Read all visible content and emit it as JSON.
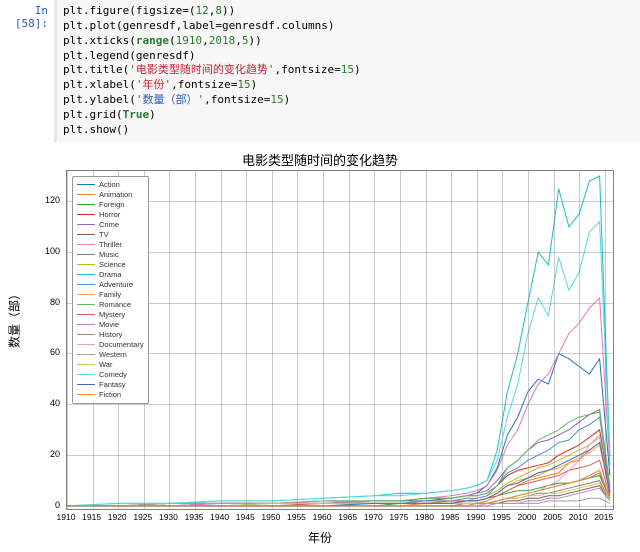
{
  "prompt": "In [58]:",
  "code": [
    [
      {
        "t": "plt.figure(figsize=("
      },
      {
        "t": "12",
        "c": "num"
      },
      {
        "t": ","
      },
      {
        "t": "8",
        "c": "num"
      },
      {
        "t": "))"
      }
    ],
    [
      {
        "t": "plt.plot(genresdf,label=genresdf.columns)"
      }
    ],
    [
      {
        "t": "plt.xticks("
      },
      {
        "t": "range",
        "c": "kw"
      },
      {
        "t": "("
      },
      {
        "t": "1910",
        "c": "num"
      },
      {
        "t": ","
      },
      {
        "t": "2018",
        "c": "num"
      },
      {
        "t": ","
      },
      {
        "t": "5",
        "c": "num"
      },
      {
        "t": "))"
      }
    ],
    [
      {
        "t": "plt.legend(genresdf)"
      }
    ],
    [
      {
        "t": "plt.title("
      },
      {
        "t": "'电影类型随时间的变化趋势'",
        "c": "str-red"
      },
      {
        "t": ",fontsize="
      },
      {
        "t": "15",
        "c": "num"
      },
      {
        "t": ")"
      }
    ],
    [
      {
        "t": "plt.xlabel("
      },
      {
        "t": "'年份'",
        "c": "str-red"
      },
      {
        "t": ",fontsize="
      },
      {
        "t": "15",
        "c": "num"
      },
      {
        "t": ")"
      }
    ],
    [
      {
        "t": "plt.ylabel("
      },
      {
        "t": "'数量（部）'",
        "c": "str-blue"
      },
      {
        "t": ",fontsize="
      },
      {
        "t": "15",
        "c": "num"
      },
      {
        "t": ")"
      }
    ],
    [
      {
        "t": "plt.grid("
      },
      {
        "t": "True",
        "c": "kw"
      },
      {
        "t": ")"
      }
    ],
    [
      {
        "t": "plt.show()"
      }
    ]
  ],
  "chart_data": {
    "type": "line",
    "title": "电影类型随时间的变化趋势",
    "xlabel": "年份",
    "ylabel": "数量（部）",
    "xlim": [
      1910,
      2017
    ],
    "ylim": [
      -2,
      132
    ],
    "xticks": [
      1910,
      1915,
      1920,
      1925,
      1930,
      1935,
      1940,
      1945,
      1950,
      1955,
      1960,
      1965,
      1970,
      1975,
      1980,
      1985,
      1990,
      1995,
      2000,
      2005,
      2010,
      2015
    ],
    "yticks": [
      0,
      20,
      40,
      60,
      80,
      100,
      120
    ],
    "x": [
      1910,
      1920,
      1930,
      1940,
      1950,
      1960,
      1970,
      1975,
      1980,
      1985,
      1988,
      1990,
      1992,
      1994,
      1996,
      1998,
      2000,
      2002,
      2004,
      2006,
      2008,
      2010,
      2012,
      2014,
      2016
    ],
    "series": [
      {
        "name": "Action",
        "color": "#1f77b4",
        "v": [
          0,
          0,
          0,
          1,
          1,
          1,
          2,
          2,
          2,
          3,
          4,
          5,
          8,
          15,
          28,
          35,
          45,
          50,
          48,
          60,
          58,
          55,
          52,
          58,
          12
        ]
      },
      {
        "name": "Animation",
        "color": "#ff7f0e",
        "v": [
          0,
          0,
          0,
          0,
          0,
          0,
          0,
          0,
          1,
          1,
          1,
          1,
          2,
          4,
          6,
          8,
          10,
          11,
          12,
          13,
          17,
          18,
          22,
          25,
          6
        ]
      },
      {
        "name": "Foreign",
        "color": "#2ca02c",
        "v": [
          0,
          0,
          0,
          0,
          0,
          0,
          0,
          1,
          1,
          1,
          2,
          2,
          3,
          4,
          5,
          6,
          6,
          7,
          8,
          9,
          9,
          10,
          11,
          12,
          3
        ]
      },
      {
        "name": "Horror",
        "color": "#d62728",
        "v": [
          0,
          0,
          1,
          1,
          1,
          1,
          2,
          2,
          3,
          3,
          4,
          4,
          5,
          8,
          12,
          14,
          15,
          16,
          17,
          20,
          22,
          24,
          27,
          30,
          6
        ]
      },
      {
        "name": "Crime",
        "color": "#9467bd",
        "v": [
          0,
          0,
          1,
          1,
          1,
          2,
          2,
          2,
          3,
          3,
          4,
          5,
          6,
          10,
          15,
          18,
          22,
          25,
          26,
          28,
          30,
          33,
          36,
          38,
          8
        ]
      },
      {
        "name": "TV",
        "color": "#8c564b",
        "v": [
          0,
          0,
          0,
          0,
          0,
          0,
          0,
          0,
          0,
          0,
          0,
          0,
          1,
          1,
          2,
          2,
          3,
          3,
          4,
          4,
          5,
          6,
          7,
          8,
          2
        ]
      },
      {
        "name": "Thriller",
        "color": "#e377c2",
        "v": [
          0,
          0,
          0,
          1,
          1,
          1,
          2,
          2,
          3,
          4,
          5,
          6,
          8,
          14,
          24,
          30,
          40,
          48,
          52,
          60,
          68,
          72,
          78,
          82,
          16
        ]
      },
      {
        "name": "Music",
        "color": "#7f7f7f",
        "v": [
          0,
          0,
          0,
          0,
          0,
          0,
          0,
          0,
          0,
          0,
          0,
          1,
          1,
          2,
          3,
          3,
          4,
          5,
          5,
          6,
          7,
          8,
          9,
          10,
          2
        ]
      },
      {
        "name": "Science",
        "color": "#bcbd22",
        "v": [
          0,
          0,
          0,
          0,
          0,
          1,
          1,
          1,
          2,
          2,
          2,
          3,
          4,
          6,
          9,
          11,
          13,
          15,
          16,
          18,
          20,
          22,
          24,
          27,
          5
        ]
      },
      {
        "name": "Drama",
        "color": "#17becf",
        "v": [
          0,
          1,
          1,
          2,
          2,
          3,
          4,
          5,
          5,
          6,
          7,
          8,
          10,
          22,
          45,
          60,
          80,
          100,
          95,
          125,
          110,
          115,
          128,
          130,
          20
        ]
      },
      {
        "name": "Adventure",
        "color": "#5b8dc7",
        "v": [
          0,
          0,
          0,
          0,
          1,
          1,
          1,
          1,
          2,
          2,
          3,
          3,
          4,
          8,
          13,
          15,
          18,
          20,
          22,
          25,
          26,
          30,
          32,
          35,
          7
        ]
      },
      {
        "name": "Family",
        "color": "#ff9e4a",
        "v": [
          0,
          0,
          0,
          0,
          0,
          0,
          1,
          1,
          1,
          1,
          2,
          2,
          3,
          5,
          8,
          10,
          11,
          12,
          14,
          15,
          17,
          19,
          21,
          24,
          5
        ]
      },
      {
        "name": "Romance",
        "color": "#5fbe5f",
        "v": [
          0,
          0,
          1,
          1,
          1,
          2,
          2,
          2,
          3,
          3,
          4,
          4,
          5,
          8,
          15,
          18,
          22,
          26,
          28,
          30,
          33,
          35,
          36,
          37,
          8
        ]
      },
      {
        "name": "Mystery",
        "color": "#e05a5a",
        "v": [
          0,
          0,
          0,
          0,
          0,
          1,
          1,
          1,
          1,
          2,
          2,
          2,
          3,
          4,
          6,
          8,
          9,
          10,
          11,
          12,
          14,
          15,
          16,
          18,
          4
        ]
      },
      {
        "name": "Movie",
        "color": "#aa88cc",
        "v": [
          0,
          0,
          0,
          0,
          0,
          0,
          0,
          0,
          0,
          0,
          0,
          0,
          0,
          1,
          1,
          1,
          2,
          2,
          3,
          3,
          4,
          5,
          6,
          7,
          2
        ]
      },
      {
        "name": "History",
        "color": "#b0866f",
        "v": [
          0,
          0,
          0,
          0,
          0,
          0,
          0,
          0,
          0,
          0,
          1,
          1,
          1,
          2,
          3,
          4,
          5,
          6,
          7,
          8,
          9,
          10,
          11,
          13,
          3
        ]
      },
      {
        "name": "Documentary",
        "color": "#eb9cd2",
        "v": [
          0,
          0,
          0,
          0,
          0,
          0,
          0,
          0,
          0,
          0,
          0,
          0,
          1,
          2,
          3,
          4,
          5,
          6,
          8,
          10,
          14,
          18,
          24,
          28,
          5
        ]
      },
      {
        "name": "Western",
        "color": "#a0a0a0",
        "v": [
          0,
          0,
          1,
          1,
          1,
          2,
          1,
          1,
          1,
          1,
          1,
          1,
          1,
          1,
          1,
          1,
          1,
          1,
          2,
          2,
          2,
          2,
          3,
          3,
          1
        ]
      },
      {
        "name": "War",
        "color": "#cccc5a",
        "v": [
          0,
          0,
          0,
          0,
          1,
          1,
          1,
          1,
          1,
          1,
          1,
          1,
          1,
          2,
          3,
          3,
          4,
          4,
          5,
          5,
          6,
          7,
          8,
          9,
          2
        ]
      },
      {
        "name": "Comedy",
        "color": "#57d7e2",
        "v": [
          0,
          1,
          1,
          2,
          2,
          3,
          4,
          4,
          5,
          6,
          7,
          8,
          10,
          18,
          35,
          48,
          68,
          82,
          75,
          98,
          85,
          92,
          108,
          112,
          18
        ]
      },
      {
        "name": "Fantasy",
        "color": "#3b6eb5",
        "v": [
          0,
          0,
          0,
          0,
          0,
          0,
          1,
          1,
          1,
          1,
          2,
          2,
          3,
          5,
          8,
          9,
          11,
          13,
          14,
          16,
          18,
          20,
          22,
          25,
          5
        ]
      },
      {
        "name": "Fiction",
        "color": "#e68a2e",
        "v": [
          0,
          0,
          0,
          0,
          0,
          0,
          0,
          0,
          0,
          0,
          0,
          1,
          1,
          2,
          3,
          4,
          5,
          6,
          7,
          8,
          9,
          10,
          12,
          14,
          3
        ]
      }
    ]
  }
}
